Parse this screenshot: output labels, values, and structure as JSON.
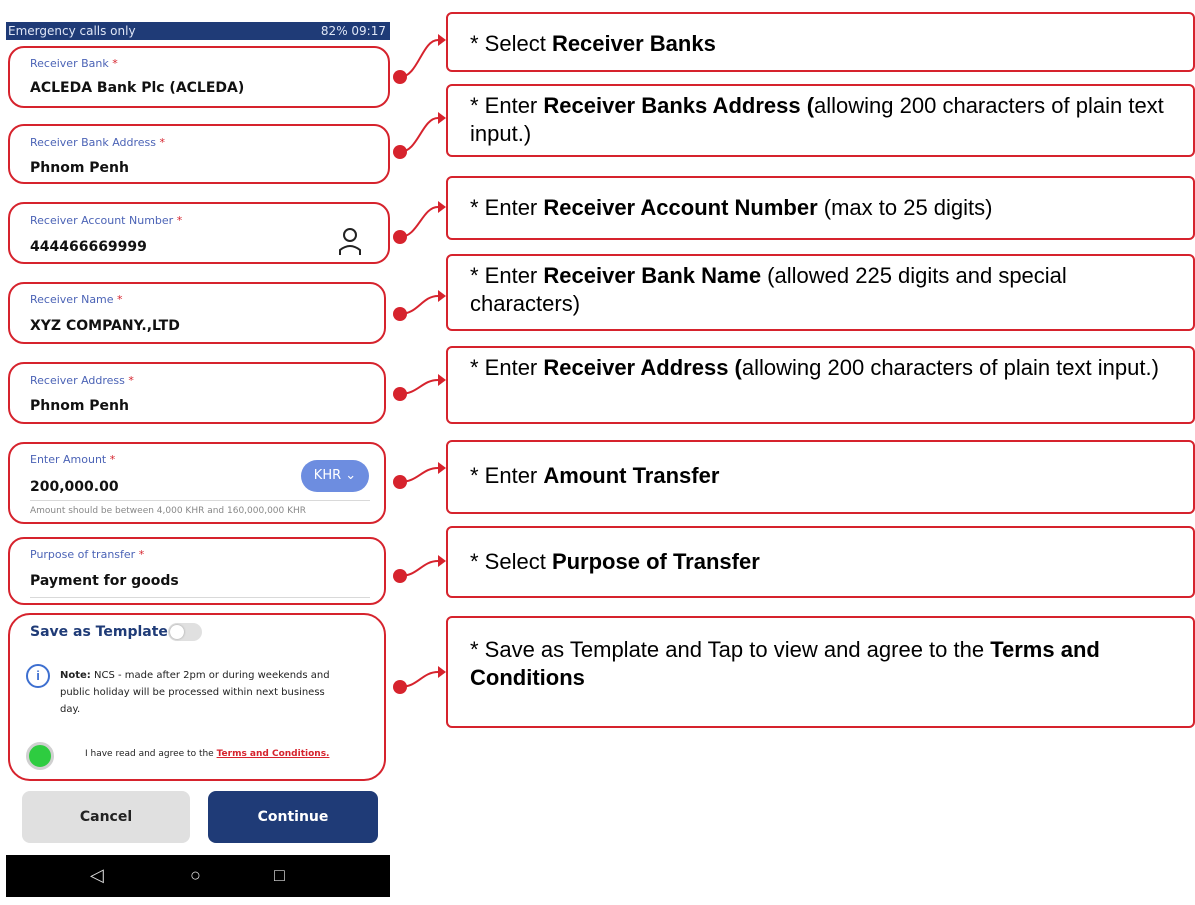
{
  "status_bar": {
    "left": "Emergency calls only",
    "right": "82% 09:17"
  },
  "fields": {
    "receiver_bank": {
      "label": "Receiver Bank",
      "value": "ACLEDA Bank Plc (ACLEDA)"
    },
    "receiver_bank_address": {
      "label": "Receiver Bank Address",
      "value": "Phnom Penh"
    },
    "receiver_account_number": {
      "label": "Receiver Account Number",
      "value": "444466669999"
    },
    "receiver_name": {
      "label": "Receiver Name",
      "value": "XYZ COMPANY.,LTD"
    },
    "receiver_address": {
      "label": "Receiver Address",
      "value": "Phnom Penh"
    },
    "amount": {
      "label": "Enter Amount",
      "value": "200,000.00",
      "currency": "KHR",
      "hint": "Amount should be between 4,000 KHR and 160,000,000 KHR"
    },
    "purpose": {
      "label": "Purpose of transfer",
      "value": "Payment for goods"
    }
  },
  "required_marker": "*",
  "save_template": {
    "label": "Save as Template",
    "enabled": false
  },
  "note": {
    "bold": "Note:",
    "text": " NCS - made after 2pm or during weekends and public holiday will be processed within next business day."
  },
  "agree": {
    "text": "I have read and agree to the ",
    "link": "Terms and Conditions."
  },
  "buttons": {
    "cancel": "Cancel",
    "continue": "Continue"
  },
  "callouts": {
    "c1": {
      "pre": "* Select ",
      "bold": "Receiver Banks",
      "post": ""
    },
    "c2": {
      "pre": "* Enter ",
      "bold": "Receiver Banks Address (",
      "post": "allowing 200 characters of plain text input.)"
    },
    "c3": {
      "pre": "* Enter ",
      "bold": "Receiver Account Number",
      "post": " (max to 25 digits)"
    },
    "c4": {
      "pre": "* Enter ",
      "bold": "Receiver Bank Name",
      "post": " (allowed 225 digits and special characters)"
    },
    "c5": {
      "pre": "* Enter ",
      "bold": "Receiver Address (",
      "post": "allowing 200 characters of plain text input.)"
    },
    "c6": {
      "pre": "* Enter ",
      "bold": "Amount Transfer",
      "post": ""
    },
    "c7": {
      "pre": "* Select ",
      "bold": "Purpose of Transfer",
      "post": ""
    },
    "c8": {
      "pre": "* Save as Template and Tap to view and agree to the ",
      "bold": "Terms and Conditions",
      "post": ""
    }
  },
  "colors": {
    "accent_red": "#d6232d",
    "navy": "#1f3b77",
    "label_blue": "#4b63b6"
  }
}
